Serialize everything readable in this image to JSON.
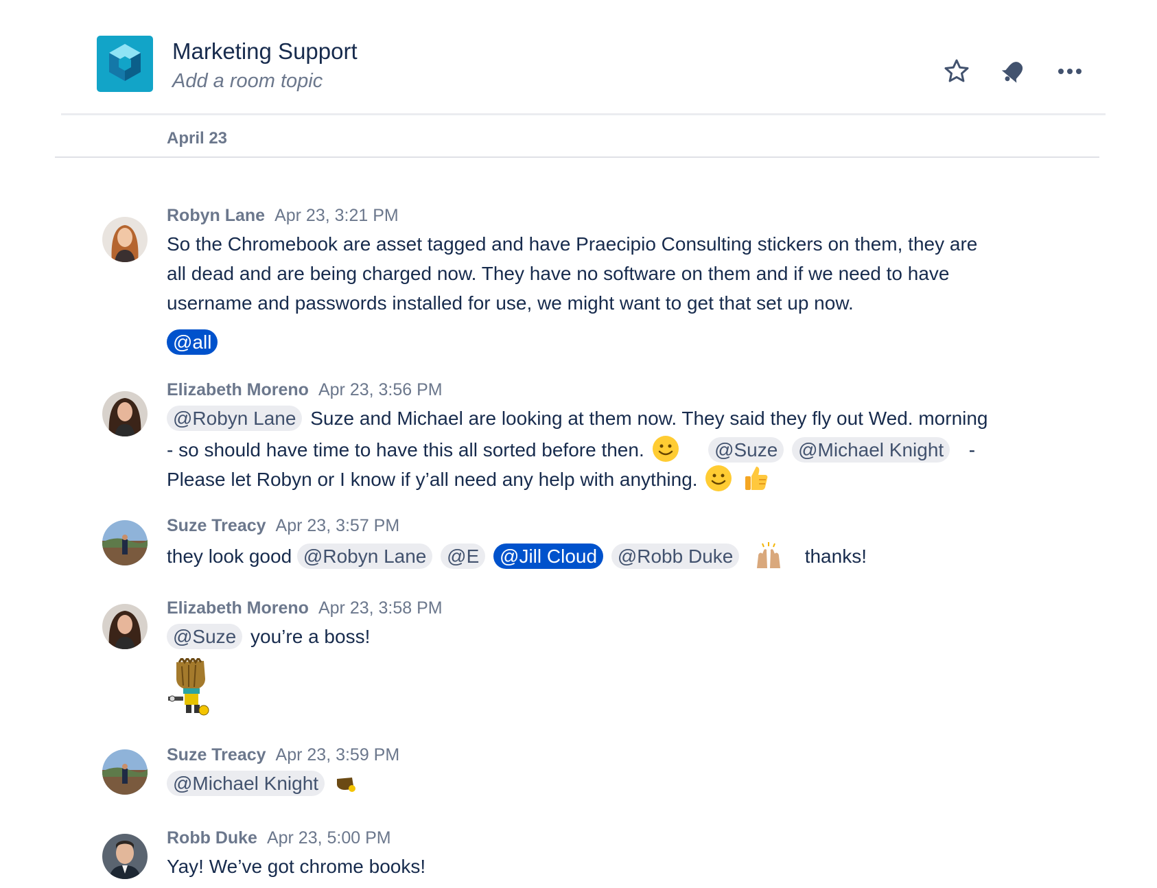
{
  "room": {
    "name": "Marketing Support",
    "topic_placeholder": "Add a room topic",
    "logo_icon": "cube-logo-icon",
    "actions": [
      "star-icon",
      "notification-bell-icon",
      "more-options-icon"
    ]
  },
  "date_divider": "April 23",
  "colors": {
    "mention_bg": "#ebecf0",
    "self_mention_bg": "#0052cc",
    "logo_bg": "#12a4c8",
    "meta_text": "#6b778c"
  },
  "messages": [
    {
      "author": "Robyn Lane",
      "time": "Apr 23, 3:21 PM",
      "lines": [
        "So the Chromebook are asset tagged and have Praecipio Consulting stickers on them, they are",
        "all dead and are being charged now.  They have no software on them and if we need to have",
        "username and passwords installed for use, we might want to get that set up now."
      ],
      "mention_all": "@all"
    },
    {
      "author": "Elizabeth Moreno",
      "time": "Apr 23, 3:56 PM",
      "mention_1": "@Robyn Lane",
      "text_1": "Suze and Michael are looking at them now. They said they fly out Wed. morning",
      "text_2": "- so should have time to have this all sorted before then.",
      "mention_2": "@Suze",
      "mention_3": "@Michael Knight",
      "text_3": "-",
      "text_4": "Please let Robyn or I know if y’all need any help with anything."
    },
    {
      "author": "Suze Treacy",
      "time": "Apr 23, 3:57 PM",
      "text_1": "they look good",
      "mention_1": "@Robyn Lane",
      "mention_2": "@E",
      "mention_3": "@Jill Cloud",
      "mention_4": "@Robb Duke",
      "text_2": "thanks!"
    },
    {
      "author": "Elizabeth Moreno",
      "time": "Apr 23, 3:58 PM",
      "mention_1": "@Suze",
      "text_1": "you’re a boss!",
      "sticker": "pixel-boss-sticker"
    },
    {
      "author": "Suze Treacy",
      "time": "Apr 23, 3:59 PM",
      "mention_1": "@Michael Knight",
      "emoticon": "small-boss-emoticon"
    },
    {
      "author": "Robb Duke",
      "time": "Apr 23, 5:00 PM",
      "text_1": "Yay! We’ve got chrome books!"
    }
  ]
}
